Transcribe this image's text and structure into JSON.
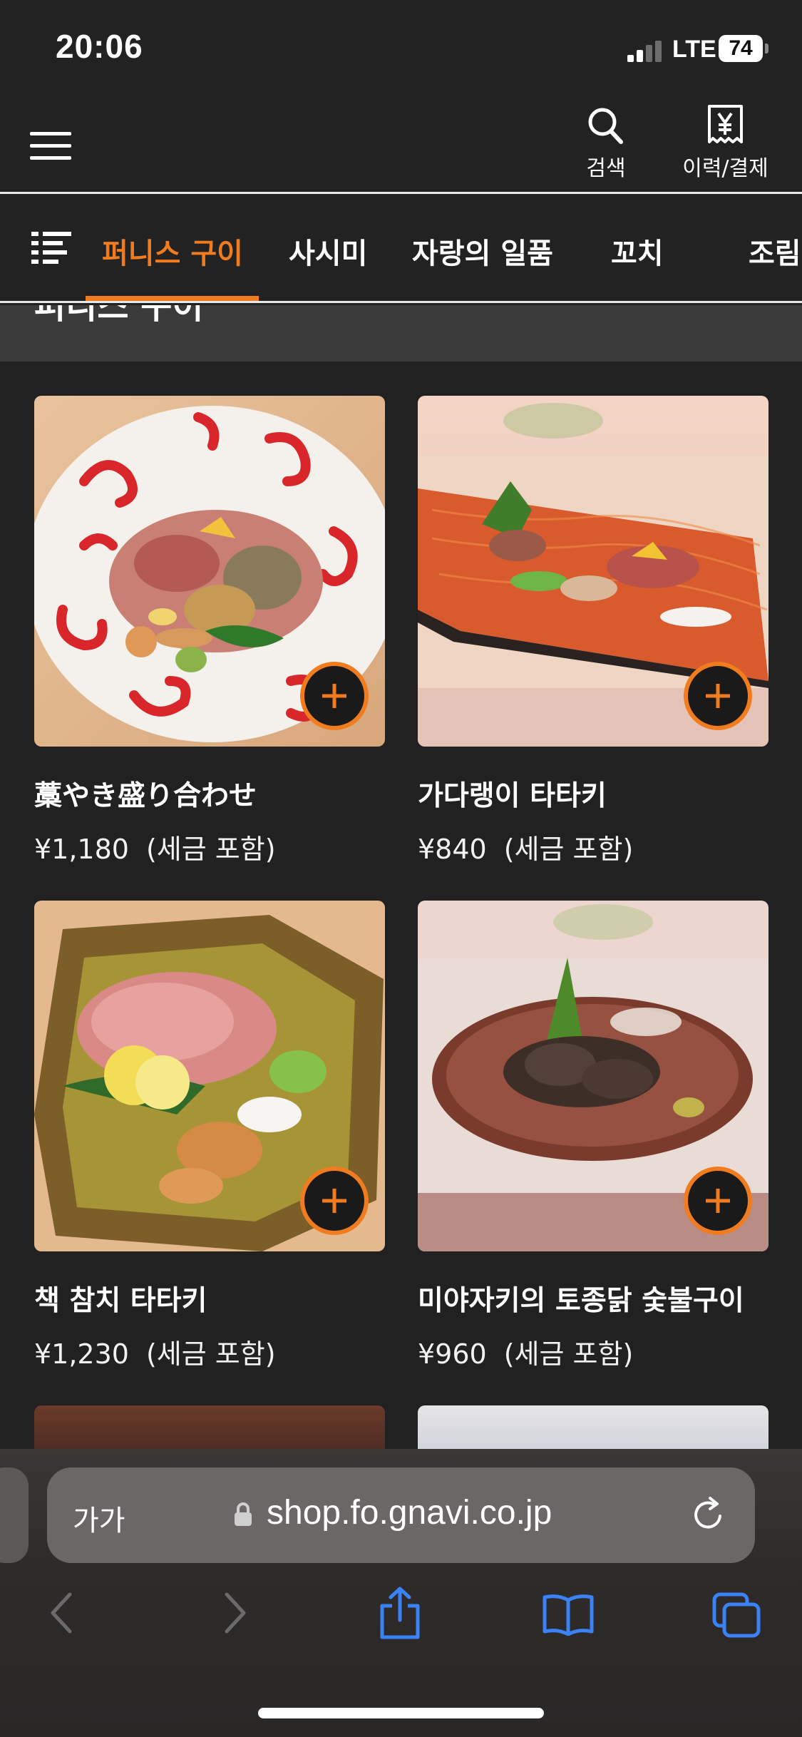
{
  "status_bar": {
    "time": "20:06",
    "network": "LTE",
    "battery": "74"
  },
  "header": {
    "search_label": "검색",
    "history_label": "이력/결제"
  },
  "tabs": {
    "items": [
      "퍼니스 구이",
      "사시미",
      "자랑의 일품",
      "꼬치",
      "조림"
    ],
    "active_index": 0
  },
  "section": {
    "title": "퍼니스 구이"
  },
  "products": [
    {
      "name": "藁やき盛り合わせ",
      "price": "¥1,180",
      "tax_note": "(세금 포함)"
    },
    {
      "name": "가다랭이 타타키",
      "price": "¥840",
      "tax_note": "(세금 포함)"
    },
    {
      "name": "책 참치 타타키",
      "price": "¥1,230",
      "tax_note": "(세금 포함)"
    },
    {
      "name": "미야자키의 토종닭 숯불구이",
      "price": "¥960",
      "tax_note": "(세금 포함)"
    }
  ],
  "browser": {
    "text_size_label": "가가",
    "url": "shop.fo.gnavi.co.jp"
  },
  "colors": {
    "accent": "#f07c1f",
    "background": "#212121",
    "browser_blue": "#3b82f6"
  },
  "icons": [
    "menu-icon",
    "search-icon",
    "receipt-yen-icon",
    "list-icon",
    "plus-icon",
    "lock-icon",
    "reload-icon",
    "back-icon",
    "forward-icon",
    "share-icon",
    "bookmarks-icon",
    "tabs-icon"
  ]
}
